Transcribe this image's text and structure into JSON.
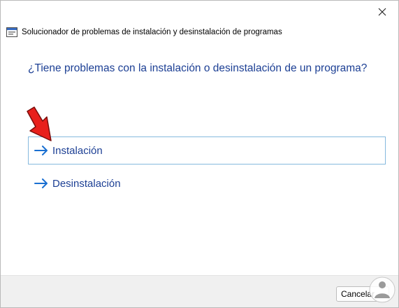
{
  "window": {
    "title": "Solucionador de problemas de instalación y desinstalación de programas",
    "close_icon": "close-icon"
  },
  "content": {
    "question": "¿Tiene problemas con la instalación o desinstalación de un programa?",
    "options": [
      {
        "label": "Instalación",
        "icon": "arrow-right-icon",
        "selected": true
      },
      {
        "label": "Desinstalación",
        "icon": "arrow-right-icon",
        "selected": false
      }
    ]
  },
  "footer": {
    "cancel_label": "Cancelar"
  },
  "colors": {
    "accent_text": "#1c3f94",
    "arrow_blue": "#1a6fd1",
    "selection_border": "#85b9de",
    "annotation_red": "#e8201c"
  }
}
